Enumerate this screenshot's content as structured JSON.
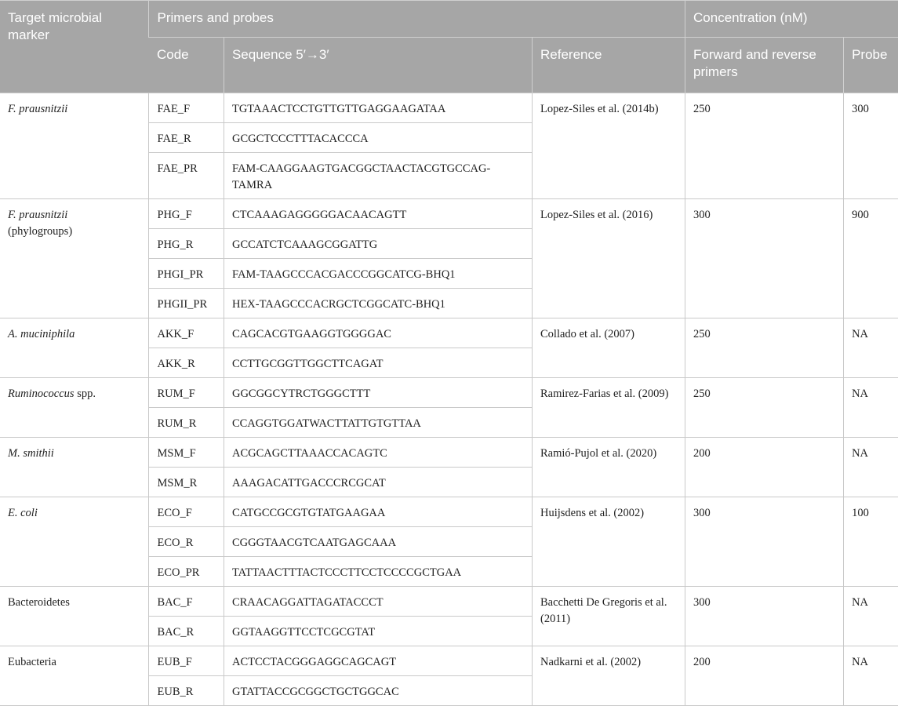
{
  "headers": {
    "target": "Target microbial marker",
    "primers_probes": "Primers and probes",
    "concentration": "Concentration (nM)",
    "code": "Code",
    "sequence": "Sequence 5′→3′",
    "reference": "Reference",
    "fwd_rev": "Forward and reverse primers",
    "probe": "Probe"
  },
  "groups": [
    {
      "target": "F. prausnitzii",
      "target_extra": "",
      "reference": "Lopez-Siles et al. (2014b)",
      "conc": "250",
      "probe": "300",
      "rows": [
        {
          "code": "FAE_F",
          "seq": "TGTAAACTCCTGTTGTTGAGGAAGATAA"
        },
        {
          "code": "FAE_R",
          "seq": "GCGCTCCCTTTACACCCA"
        },
        {
          "code": "FAE_PR",
          "seq": "FAM-CAAGGAAGTGACGGCTAACTACGTGCCAG-TAMRA"
        }
      ]
    },
    {
      "target": "F. prausnitzii",
      "target_extra": "(phylogroups)",
      "reference": "Lopez-Siles et al. (2016)",
      "conc": "300",
      "probe": "900",
      "rows": [
        {
          "code": "PHG_F",
          "seq": "CTCAAAGAGGGGGACAACAGTT"
        },
        {
          "code": "PHG_R",
          "seq": "GCCATCTCAAAGCGGATTG"
        },
        {
          "code": "PHGI_PR",
          "seq": "FAM-TAAGCCCACGACCCGGCATCG-BHQ1"
        },
        {
          "code": "PHGII_PR",
          "seq": "HEX-TAAGCCCACRGCTCGGCATC-BHQ1"
        }
      ]
    },
    {
      "target": "A. muciniphila",
      "target_extra": "",
      "reference": "Collado et al. (2007)",
      "conc": "250",
      "probe": "NA",
      "rows": [
        {
          "code": "AKK_F",
          "seq": "CAGCACGTGAAGGTGGGGAC"
        },
        {
          "code": "AKK_R",
          "seq": "CCTTGCGGTTGGCTTCAGAT"
        }
      ]
    },
    {
      "target": "Ruminococcus",
      "target_extra": " spp.",
      "reference": "Ramirez-Farias et al. (2009)",
      "conc": "250",
      "probe": "NA",
      "rows": [
        {
          "code": "RUM_F",
          "seq": "GGCGGCYTRCTGGGCTTT"
        },
        {
          "code": "RUM_R",
          "seq": "CCAGGTGGATWACTTATTGTGTTAA"
        }
      ]
    },
    {
      "target": "M. smithii",
      "target_extra": "",
      "reference": "Ramió-Pujol et al. (2020)",
      "conc": "200",
      "probe": "NA",
      "rows": [
        {
          "code": "MSM_F",
          "seq": "ACGCAGCTTAAACCACAGTC"
        },
        {
          "code": "MSM_R",
          "seq": "AAAGACATTGACCCRCGCAT"
        }
      ]
    },
    {
      "target": "E. coli",
      "target_extra": "",
      "reference": "Huijsdens et al. (2002)",
      "conc": "300",
      "probe": "100",
      "rows": [
        {
          "code": "ECO_F",
          "seq": "CATGCCGCGTGTATGAAGAA"
        },
        {
          "code": "ECO_R",
          "seq": "CGGGTAACGTCAATGAGCAAA"
        },
        {
          "code": "ECO_PR",
          "seq": "TATTAACTTTACTCCCTTCCTCCCCGCTGAA"
        }
      ]
    },
    {
      "target": "Bacteroidetes",
      "target_extra": "",
      "reference": "Bacchetti De Gregoris et al. (2011)",
      "conc": "300",
      "probe": "NA",
      "rows": [
        {
          "code": "BAC_F",
          "seq": "CRAACAGGATTAGATACCCT"
        },
        {
          "code": "BAC_R",
          "seq": "GGTAAGGTTCCTCGCGTAT"
        }
      ]
    },
    {
      "target": "Eubacteria",
      "target_extra": "",
      "reference": "Nadkarni et al. (2002)",
      "conc": "200",
      "probe": "NA",
      "rows": [
        {
          "code": "EUB_F",
          "seq": "ACTCCTACGGGAGGCAGCAGT"
        },
        {
          "code": "EUB_R",
          "seq": "GTATTACCGCGGCTGCTGGCAC"
        }
      ]
    }
  ]
}
